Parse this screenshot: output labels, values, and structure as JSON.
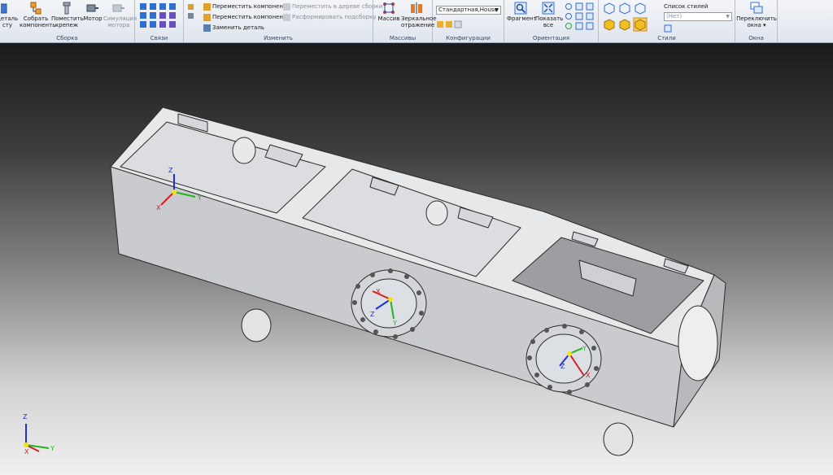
{
  "groups": {
    "assembly": {
      "title": "Сборка",
      "btn_add_part": "деталь\nсту",
      "btn_assemble": "Собрать\nкомпоненты",
      "btn_place_fastener": "Поместить\nкрепеж",
      "btn_motor": "Мотор",
      "btn_motor_sim": "Симуляция\nмотора"
    },
    "links": {
      "title": "Связи"
    },
    "modify": {
      "title": "Изменить",
      "move_component": "Переместить компонент",
      "move_in_tree": "Переместить в дереве сборки",
      "rearrange_components": "Переместить компоненты",
      "disband_subassembly": "Расформировать подсборку",
      "replace_part": "Заменить деталь"
    },
    "arrays": {
      "title": "Массивы",
      "btn_array": "Массив",
      "btn_mirror": "Зеркальное\nотражение"
    },
    "configs": {
      "title": "Конфигурации",
      "current": "Стандартная,House"
    },
    "orientation": {
      "title": "Ориентация",
      "btn_fragment": "Фрагмент",
      "btn_show_all": "Показать\nвсе"
    },
    "styles": {
      "title": "Стили",
      "list_label": "Список стилей",
      "list_value": "(Нет)"
    },
    "windows": {
      "title": "Окна",
      "btn_switch": "Переключить\nокна ▾"
    }
  },
  "triad": {
    "x": "X",
    "y": "Y",
    "z": "Z"
  },
  "colors": {
    "x_axis": "#d42020",
    "y_axis": "#22b522",
    "z_axis": "#2030d8",
    "origin": "#f2e21a"
  }
}
